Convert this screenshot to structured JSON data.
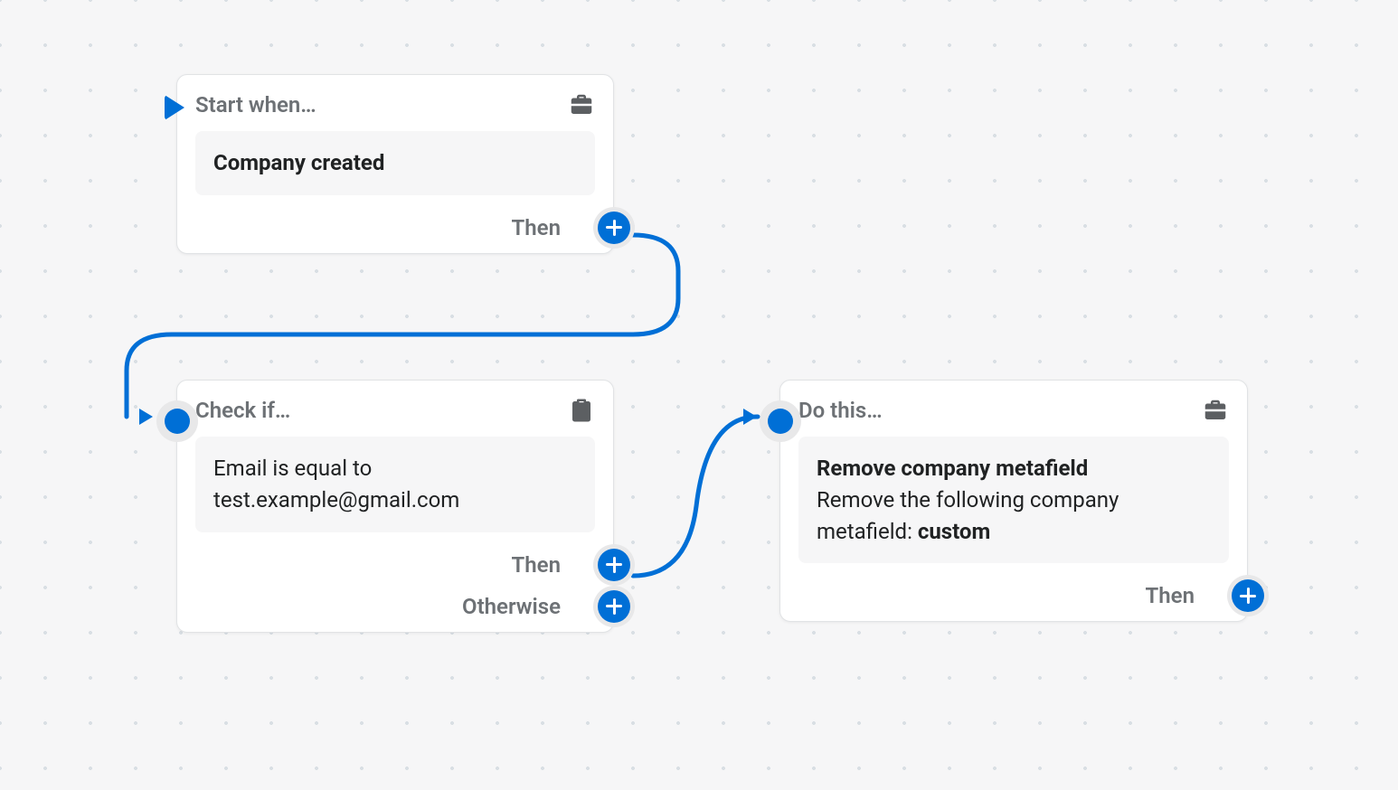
{
  "nodes": {
    "start": {
      "title": "Start when…",
      "event": "Company created",
      "outputs": {
        "then": "Then"
      }
    },
    "check": {
      "title": "Check if…",
      "condition_text": "Email is equal to test.example@gmail.com",
      "outputs": {
        "then": "Then",
        "otherwise": "Otherwise"
      }
    },
    "action": {
      "title": "Do this…",
      "action_name": "Remove company metafield",
      "action_desc_prefix": "Remove the following company metafield: ",
      "action_desc_value": "custom",
      "outputs": {
        "then": "Then"
      }
    }
  }
}
